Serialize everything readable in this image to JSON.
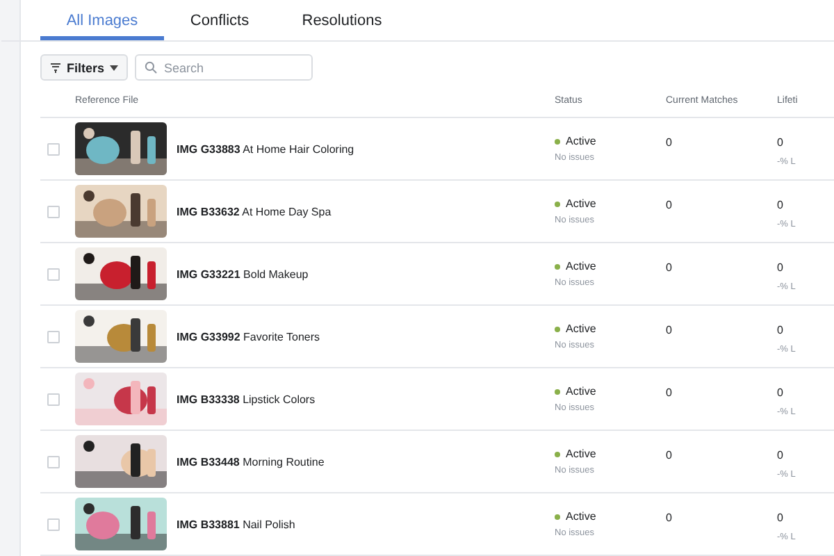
{
  "tabs": [
    {
      "label": "All Images",
      "selected": true
    },
    {
      "label": "Conflicts",
      "selected": false
    },
    {
      "label": "Resolutions",
      "selected": false
    }
  ],
  "filters": {
    "label": "Filters"
  },
  "search": {
    "placeholder": "Search"
  },
  "table": {
    "columns": [
      "Reference File",
      "Status",
      "Current Matches",
      "Lifeti"
    ],
    "rows": [
      {
        "checked": false,
        "code": "IMG G33883",
        "title": "At Home Hair Coloring",
        "status": "Active",
        "note": "No issues",
        "current": "0",
        "lifetime": "0",
        "lifetime_note": "-% L"
      },
      {
        "checked": false,
        "code": "IMG B33632",
        "title": "At Home Day Spa",
        "status": "Active",
        "note": "No issues",
        "current": "0",
        "lifetime": "0",
        "lifetime_note": "-% L"
      },
      {
        "checked": false,
        "code": "IMG G33221",
        "title": "Bold Makeup",
        "status": "Active",
        "note": "No issues",
        "current": "0",
        "lifetime": "0",
        "lifetime_note": "-% L"
      },
      {
        "checked": false,
        "code": "IMG G33992",
        "title": "Favorite Toners",
        "status": "Active",
        "note": "No issues",
        "current": "0",
        "lifetime": "0",
        "lifetime_note": "-% L"
      },
      {
        "checked": false,
        "code": "IMG B33338",
        "title": "Lipstick Colors",
        "status": "Active",
        "note": "No issues",
        "current": "0",
        "lifetime": "0",
        "lifetime_note": "-% L"
      },
      {
        "checked": false,
        "code": "IMG B33448",
        "title": "Morning Routine",
        "status": "Active",
        "note": "No issues",
        "current": "0",
        "lifetime": "0",
        "lifetime_note": "-% L"
      },
      {
        "checked": false,
        "code": "IMG B33881",
        "title": "Nail Polish",
        "status": "Active",
        "note": "No issues",
        "current": "0",
        "lifetime": "0",
        "lifetime_note": "-% L"
      }
    ]
  }
}
